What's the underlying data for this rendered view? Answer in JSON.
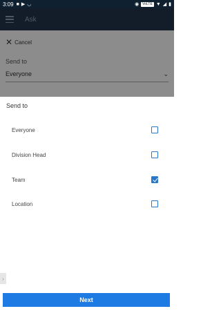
{
  "status_bar": {
    "time": "3:09",
    "left_icons": [
      "video-icon",
      "play-icon",
      "wifi-icon"
    ],
    "right_icons": [
      "alarm-icon",
      "wifi-icon",
      "signal-icon",
      "battery-icon"
    ],
    "badge": "VoLTE"
  },
  "app_bar": {
    "title": "Ask",
    "menu_icon": "menu-icon"
  },
  "background_form": {
    "cancel_label": "Cancel",
    "send_to_label": "Send to",
    "send_to_value": "Everyone"
  },
  "sheet": {
    "title": "Send to",
    "options": [
      {
        "label": "Everyone",
        "checked": false
      },
      {
        "label": "Division Head",
        "checked": false
      },
      {
        "label": "Team",
        "checked": true
      },
      {
        "label": "Location",
        "checked": false
      }
    ]
  },
  "next_button": {
    "label": "Next"
  },
  "colors": {
    "accent": "#1e7be3",
    "checkbox": "#2a76c9",
    "app_bar": "#22364c"
  }
}
